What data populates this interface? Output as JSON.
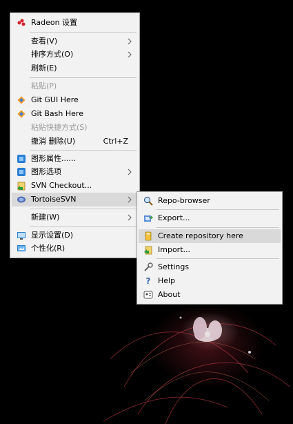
{
  "main_menu": {
    "items": [
      {
        "label": "Radeon 设置",
        "icon": "radeon-icon"
      },
      {
        "label": "查看(V)",
        "submenu": true
      },
      {
        "label": "排序方式(O)",
        "submenu": true
      },
      {
        "label": "刷新(E)"
      },
      {
        "label": "粘贴(P)",
        "disabled": true
      },
      {
        "label": "Git GUI Here",
        "icon": "git-gui-icon"
      },
      {
        "label": "Git Bash Here",
        "icon": "git-bash-icon"
      },
      {
        "label": "粘贴快捷方式(S)",
        "disabled": true
      },
      {
        "label": "撤消 删除(U)",
        "shortcut": "Ctrl+Z"
      },
      {
        "label": "图形属性......",
        "icon": "graphics-properties-icon"
      },
      {
        "label": "图形选项",
        "icon": "graphics-options-icon",
        "submenu": true
      },
      {
        "label": "SVN Checkout...",
        "icon": "svn-checkout-icon"
      },
      {
        "label": "TortoiseSVN",
        "icon": "tortoisesvn-icon",
        "submenu": true,
        "highlighted": true
      },
      {
        "label": "新建(W)",
        "submenu": true
      },
      {
        "label": "显示设置(D)",
        "icon": "display-settings-icon"
      },
      {
        "label": "个性化(R)",
        "icon": "personalize-icon"
      }
    ]
  },
  "submenu": {
    "items": [
      {
        "label": "Repo-browser",
        "icon": "repo-browser-icon"
      },
      {
        "label": "Export...",
        "icon": "export-icon"
      },
      {
        "label": "Create repository here",
        "icon": "create-repository-icon",
        "highlighted": true
      },
      {
        "label": "Import...",
        "icon": "import-icon"
      },
      {
        "label": "Settings",
        "icon": "settings-icon"
      },
      {
        "label": "Help",
        "icon": "help-icon"
      },
      {
        "label": "About",
        "icon": "about-icon"
      }
    ]
  },
  "colors": {
    "menu_background": "#f2f2f2",
    "highlight": "#d9d9d9",
    "disabled_text": "#9b9b9b",
    "separator": "#c9c9c9"
  }
}
